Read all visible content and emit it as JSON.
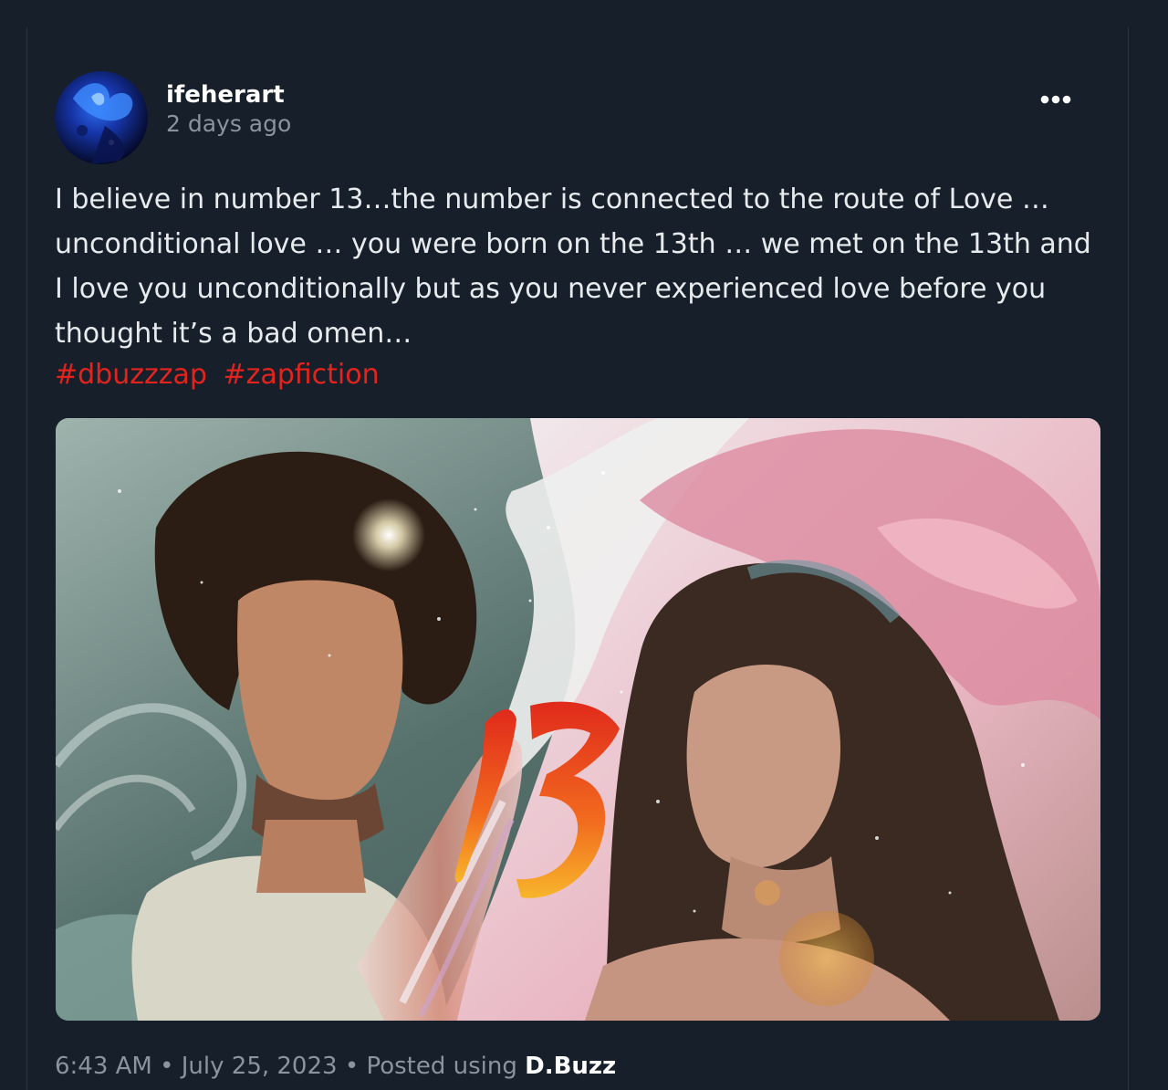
{
  "post": {
    "author": "ifeherart",
    "time_ago": "2 days ago",
    "body_lines": [
      "I believe in number 13…the number is connected to the route of Love …",
      "unconditional love … you were born on the 13th … we met on the 13th and",
      "I love you unconditionally but as you never experienced love before you",
      "thought it’s a bad omen…"
    ],
    "hashtags": [
      "#dbuzzzap",
      "#zapfiction"
    ],
    "image_overlay_text": "13",
    "footer": {
      "time": "6:43 AM",
      "separator": "•",
      "date": "July 25, 2023",
      "posted_using_label": "Posted using",
      "app_name": "D.Buzz"
    }
  },
  "icons": {
    "more": "more-options-icon",
    "avatar": "avatar-image"
  },
  "colors": {
    "background": "#17202a",
    "text": "#e8ebee",
    "muted": "#8b939c",
    "hashtag": "#e3231e",
    "border": "#2a3540"
  }
}
